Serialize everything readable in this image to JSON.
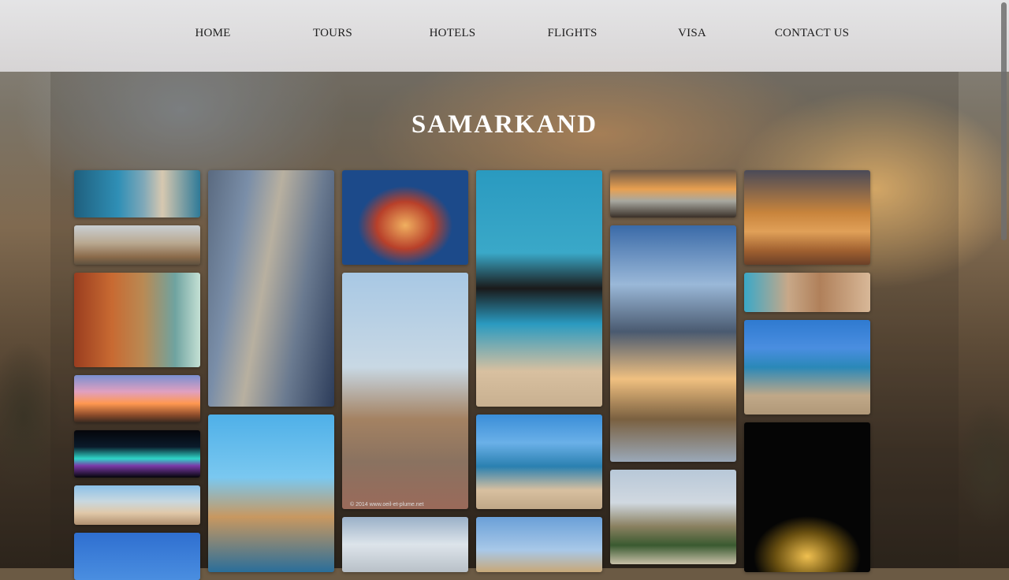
{
  "nav": {
    "items": [
      {
        "label": "HOME"
      },
      {
        "label": "TOURS"
      },
      {
        "label": "HOTELS"
      },
      {
        "label": "FLIGHTS"
      },
      {
        "label": "VISA"
      },
      {
        "label": "CONTACT US"
      }
    ]
  },
  "page": {
    "title": "SAMARKAND"
  },
  "gallery": {
    "watermark": "© 2014 www.oeil-et-plume.net"
  },
  "colors": {
    "nav_bg": "#e8e8ea",
    "title_text": "#ffffff",
    "nav_text": "#1d1d1d",
    "tile_blue": "#2f8fb6",
    "tile_gold": "#c8843c"
  }
}
